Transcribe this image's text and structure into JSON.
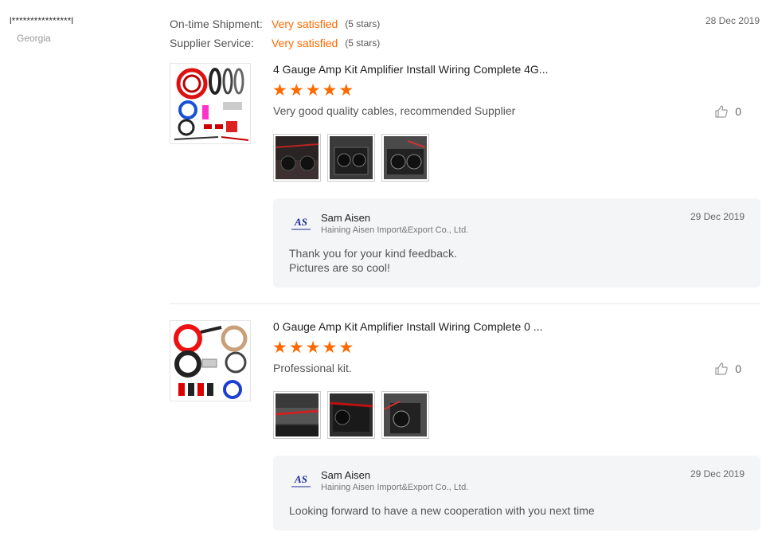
{
  "reviewer": {
    "name": "l****************l",
    "country": "Georgia"
  },
  "ratings": [
    {
      "label": "On-time Shipment:",
      "value": "Very satisfied",
      "stars": "(5 stars)"
    },
    {
      "label": "Supplier Service:",
      "value": "Very satisfied",
      "stars": "(5 stars)"
    }
  ],
  "review_date": "28 Dec 2019",
  "reviews": [
    {
      "product_title": "4 Gauge Amp Kit Amplifier Install Wiring Complete 4G...",
      "rating": 5,
      "text": "Very good quality cables, recommended Supplier",
      "likes": "0",
      "photo_count": 3,
      "reply": {
        "name": "Sam Aisen",
        "company": "Haining Aisen Import&Export Co., Ltd.",
        "date": "29 Dec 2019",
        "line1": "Thank you for your kind feedback.",
        "line2": "Pictures are so cool!"
      }
    },
    {
      "product_title": "0 Gauge Amp Kit Amplifier Install Wiring Complete 0 ...",
      "rating": 5,
      "text": "Professional kit.",
      "likes": "0",
      "photo_count": 3,
      "reply": {
        "name": "Sam Aisen",
        "company": "Haining Aisen Import&Export Co., Ltd.",
        "date": "29 Dec 2019",
        "line1": "Looking forward to have a new cooperation with you next time"
      }
    }
  ],
  "logo_text": "AS",
  "star_glyph": "★",
  "colors": {
    "accent": "#ff6a00",
    "reply_bg": "#f4f5f7"
  },
  "icons": {
    "like": "thumbs-up-icon",
    "logo": "supplier-logo"
  }
}
